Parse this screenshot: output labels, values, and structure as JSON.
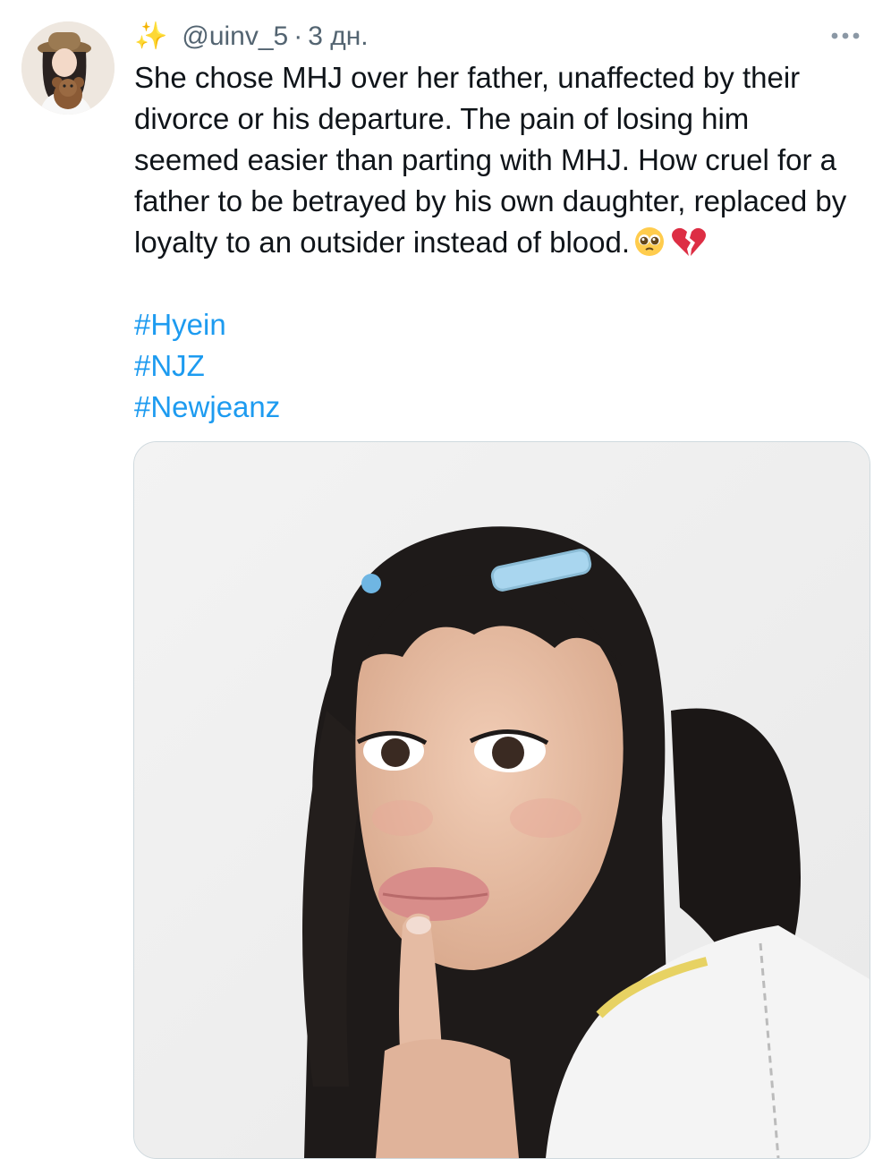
{
  "tweet": {
    "author_handle": "@uinv_5",
    "separator": "·",
    "timestamp": "3 дн.",
    "more_glyph": "•••",
    "text": "She chose MHJ over her father, unaffected by their divorce or his departure. The pain of losing him seemed easier than parting with MHJ. How cruel for a father to be betrayed by his own daughter, replaced by loyalty to an outsider instead of blood.",
    "hashtags": [
      "#Hyein",
      "#NJZ",
      "#Newjeanz"
    ]
  },
  "icons": {
    "name_decoration": "sparkles-emoji",
    "emoji_1": "pleading-face-emoji",
    "emoji_2": "broken-heart-emoji",
    "more": "more-options-icon"
  },
  "colors": {
    "link": "#1d9bf0",
    "secondary_text": "#536471",
    "primary_text": "#0f1419",
    "media_border": "#cfd9de"
  }
}
